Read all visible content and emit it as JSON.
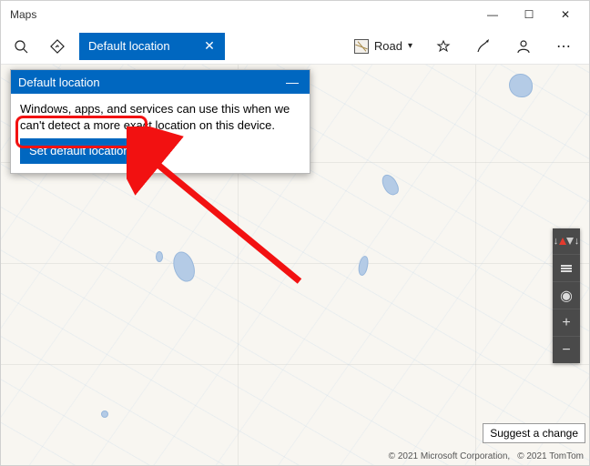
{
  "window": {
    "title": "Maps"
  },
  "toolbar": {
    "search_value": "Default location",
    "view_label": "Road",
    "icons": {
      "search": "search-icon",
      "directions": "directions-icon",
      "view": "road-view-icon",
      "favorites": "star-icon",
      "ink": "pen-icon",
      "account": "person-icon",
      "more": "more-icon"
    }
  },
  "popup": {
    "title": "Default location",
    "body": "Windows, apps, and services can use this when we can't detect a more exact location on this device.",
    "set_button": "Set default location"
  },
  "footer": {
    "suggest": "Suggest a change",
    "attrib1": "© 2021 Microsoft Corporation,",
    "attrib2": "© 2021 TomTom"
  },
  "zoom": {
    "in": "+",
    "out": "−"
  },
  "window_controls": {
    "min": "—",
    "max": "☐",
    "close": "✕"
  }
}
